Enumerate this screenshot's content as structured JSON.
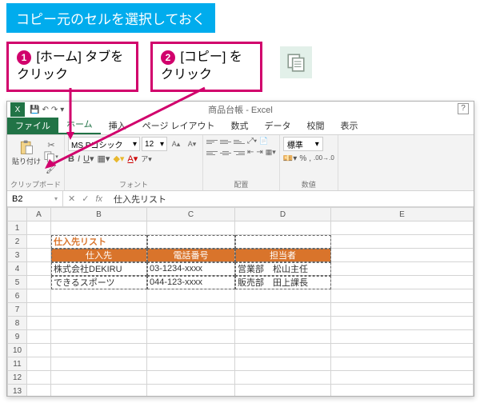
{
  "instruction_blue": "コピー元のセルを選択しておく",
  "callouts": {
    "c1": {
      "num": "❶",
      "text1": " [ホーム] タブを",
      "text2": "クリック"
    },
    "c2": {
      "num": "❷",
      "text1": " [コピー] を",
      "text2": "クリック"
    }
  },
  "window": {
    "title": "商品台帳 - Excel"
  },
  "tabs": {
    "file": "ファイル",
    "home": "ホーム",
    "insert": "挿入",
    "pagelayout": "ページ レイアウト",
    "formulas": "数式",
    "data": "データ",
    "review": "校閲",
    "view": "表示"
  },
  "ribbon": {
    "clipboard": {
      "label": "クリップボード",
      "paste": "貼り付け"
    },
    "font": {
      "label": "フォント",
      "name": "MS Pゴシック",
      "size": "12"
    },
    "alignment": {
      "label": "配置"
    },
    "number": {
      "label": "数値",
      "format": "標準"
    }
  },
  "namebox": "B2",
  "formula": "仕入先リスト",
  "columns": {
    "A": "A",
    "B": "B",
    "C": "C",
    "D": "D",
    "E": "E"
  },
  "rows": [
    "1",
    "2",
    "3",
    "4",
    "5",
    "6",
    "7",
    "8",
    "9",
    "10",
    "11",
    "12",
    "13"
  ],
  "sheet": {
    "title": "仕入先リスト",
    "headers": {
      "b": "仕入先",
      "c": "電話番号",
      "d": "担当者"
    },
    "r4": {
      "b": "株式会社DEKIRU",
      "c": "03-1234-xxxx",
      "d": "営業部　松山主任"
    },
    "r5": {
      "b": "できるスポーツ",
      "c": "044-123-xxxx",
      "d": "販売部　田上課長"
    }
  }
}
